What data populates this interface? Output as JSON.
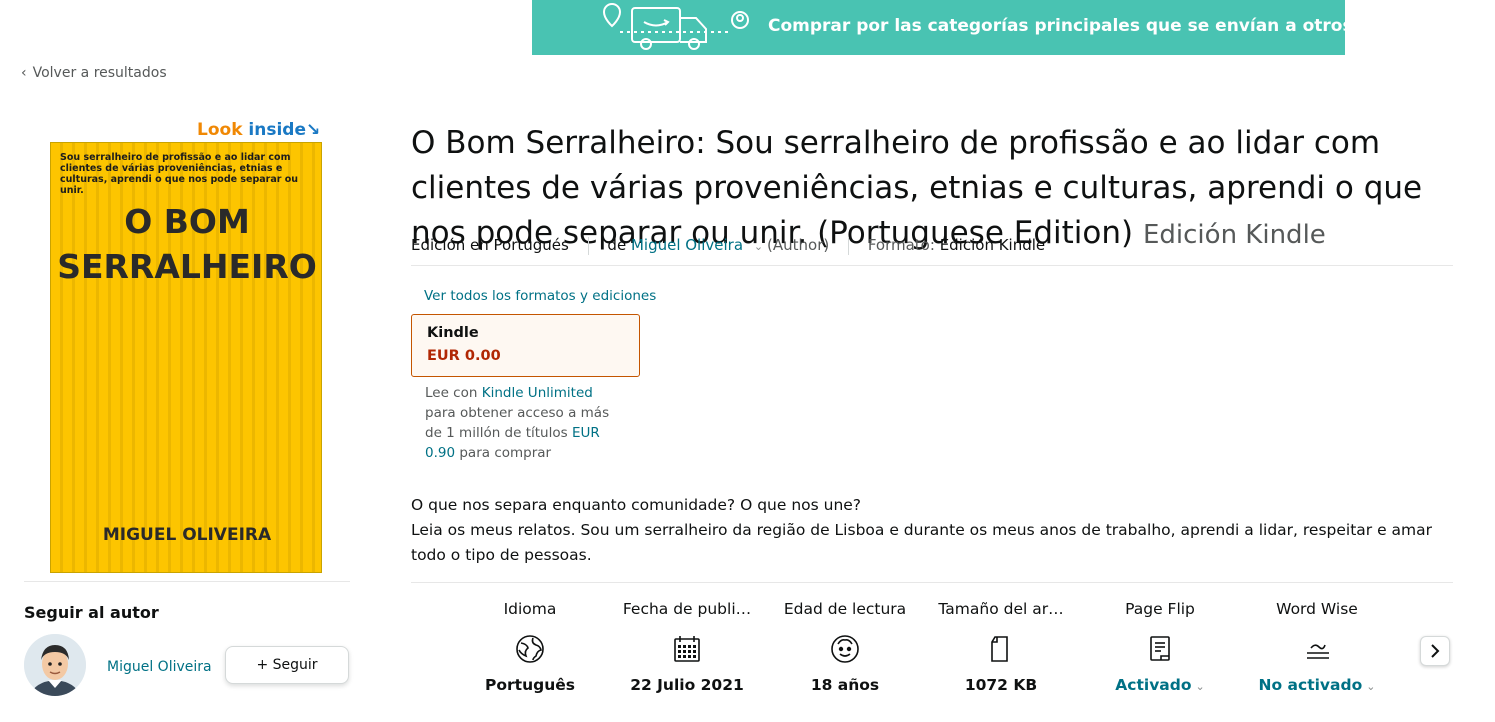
{
  "banner": {
    "text": "Comprar por las categorías principales que se envían a otros países"
  },
  "nav": {
    "back_label": "Volver a resultados"
  },
  "cover": {
    "look_label": "Look",
    "inside_label": "inside",
    "blurb": "Sou serralheiro de profissão e ao lidar com clientes de várias proveniências, etnias e culturas, aprendi o que nos pode separar ou unir.",
    "title_line1": "O BOM",
    "title_line2": "SERRALHEIRO",
    "author": "MIGUEL OLIVEIRA"
  },
  "follow": {
    "title": "Seguir al autor",
    "author_name": "Miguel Oliveira",
    "button_label": "+ Seguir"
  },
  "product": {
    "title": "O Bom Serralheiro: Sou serralheiro de profissão e ao lidar com clientes de várias proveniências, etnias e culturas, aprendi o que nos pode separar ou unir. (Portuguese Edition)",
    "edition": "Edición Kindle",
    "language_edition": "Edición en Portugués",
    "by_prefix": "de",
    "author": "Miguel Oliveira",
    "author_role": "(Author)",
    "format_label": "Formato:",
    "format_value": "Edición Kindle"
  },
  "formats": {
    "all_link": "Ver todos los formatos y ediciones",
    "selected_name": "Kindle",
    "selected_price": "EUR 0.00",
    "ku_prefix": "Lee con",
    "ku_link": "Kindle Unlimited",
    "ku_body": "para obtener acceso a más de 1 millón de títulos",
    "ku_price": "EUR 0.90",
    "ku_suffix": "para comprar"
  },
  "description": {
    "line1": "O que nos separa enquanto comunidade? O que nos une?",
    "line2": "Leia os meus relatos. Sou um serralheiro da região de Lisboa e durante os meus anos de trabalho, aprendi a lidar, respeitar e amar todo o tipo de pessoas."
  },
  "attributes": [
    {
      "label": "Idioma",
      "icon": "globe-icon",
      "value": "Português"
    },
    {
      "label": "Fecha de publi…",
      "icon": "calendar-icon",
      "value": "22 Julio 2021"
    },
    {
      "label": "Edad de lectura",
      "icon": "face-icon",
      "value": "18 años"
    },
    {
      "label": "Tamaño del ar…",
      "icon": "file-icon",
      "value": "1072 KB"
    },
    {
      "label": "Page Flip",
      "icon": "page-flip-icon",
      "value": "Activado"
    },
    {
      "label": "Word Wise",
      "icon": "word-wise-icon",
      "value": "No activado"
    }
  ],
  "colors": {
    "banner": "#49c3b2",
    "link": "#007185",
    "price": "#b12704",
    "cover": "#fdc500",
    "selected_border": "#c45500"
  }
}
